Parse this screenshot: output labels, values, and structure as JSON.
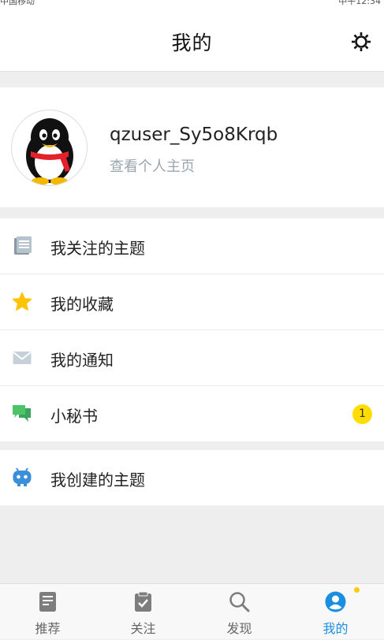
{
  "status_bar": {
    "carrier": "中国移动",
    "clock": "中午12:34"
  },
  "header": {
    "title": "我的",
    "settings_icon": "gear-icon"
  },
  "profile": {
    "username": "qzuser_Sy5o8Krqb",
    "view_homepage": "查看个人主页",
    "avatar": "qq-penguin-avatar"
  },
  "menu": {
    "items": [
      {
        "label": "我关注的主题",
        "icon": "document-list-icon"
      },
      {
        "label": "我的收藏",
        "icon": "star-icon"
      },
      {
        "label": "我的通知",
        "icon": "envelope-icon"
      },
      {
        "label": "小秘书",
        "icon": "chat-bubbles-icon",
        "badge": "1"
      }
    ],
    "created": {
      "label": "我创建的主题",
      "icon": "robot-icon"
    }
  },
  "tabbar": {
    "tabs": [
      {
        "label": "推荐",
        "icon": "article-icon"
      },
      {
        "label": "关注",
        "icon": "clipboard-check-icon"
      },
      {
        "label": "发现",
        "icon": "search-icon"
      },
      {
        "label": "我的",
        "icon": "user-icon",
        "active": true
      }
    ]
  },
  "colors": {
    "accent": "#1a8fe0",
    "badge": "#ffdd00"
  }
}
